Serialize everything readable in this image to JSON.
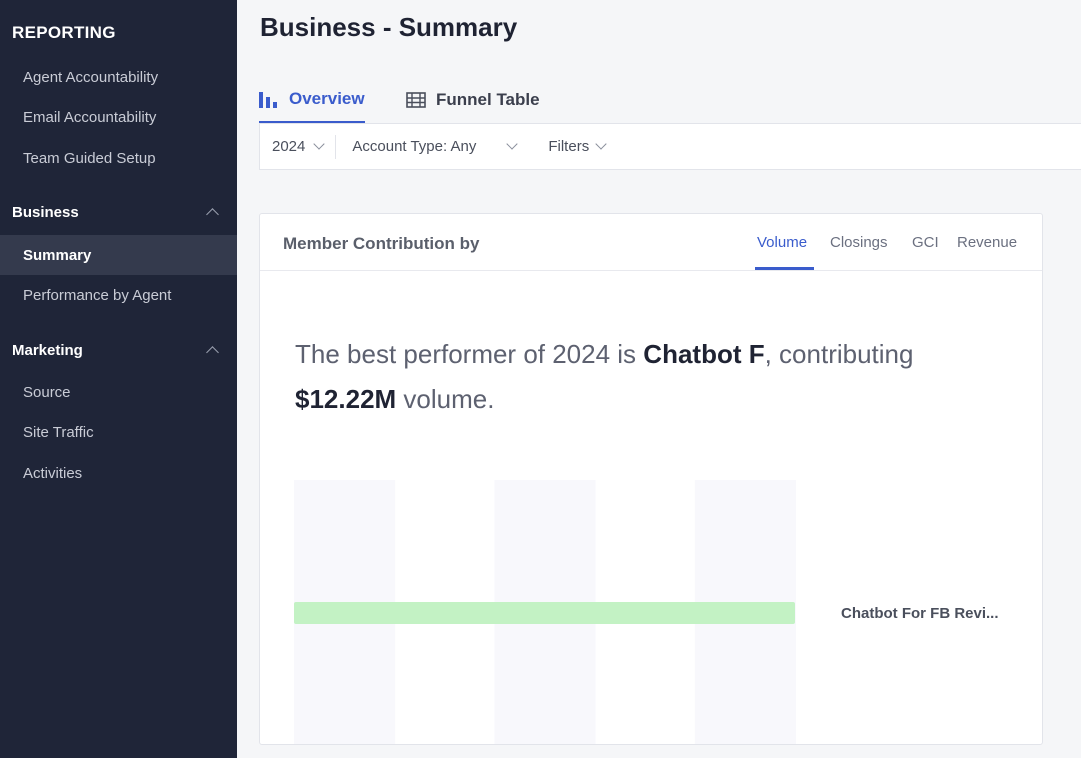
{
  "sidebar": {
    "title": "REPORTING",
    "top_items": [
      "Agent Accountability",
      "Email Accountability",
      "Team Guided Setup"
    ],
    "sections": [
      {
        "label": "Business",
        "items": [
          "Summary",
          "Performance by Agent"
        ]
      },
      {
        "label": "Marketing",
        "items": [
          "Source",
          "Site Traffic",
          "Activities"
        ]
      }
    ],
    "active_item": "Summary"
  },
  "page": {
    "title": "Business - Summary"
  },
  "tabs": [
    {
      "label": "Overview",
      "icon": "bar-chart-icon",
      "active": true
    },
    {
      "label": "Funnel Table",
      "icon": "table-icon",
      "active": false
    }
  ],
  "filters": {
    "year": "2024",
    "account_type": "Account Type: Any",
    "filters_label": "Filters"
  },
  "card": {
    "title": "Member Contribution by",
    "metric_tabs": [
      "Volume",
      "Closings",
      "GCI",
      "Revenue"
    ],
    "active_metric": "Volume",
    "headline": {
      "prefix": "The best performer of 2024 is ",
      "name": "Chatbot F",
      "middle": ", contributing",
      "amount": "$12.22M",
      "suffix": " volume."
    }
  },
  "chart_data": {
    "type": "bar",
    "orientation": "horizontal",
    "categories": [
      "Chatbot For FB Revi..."
    ],
    "values": [
      12.22
    ],
    "xlim": [
      0,
      12.22
    ],
    "bar_color": "#c3f2c4",
    "band_color": "#f8f8fc"
  },
  "colors": {
    "sidebar_bg": "#1f2538",
    "accent": "#3a5ccc"
  }
}
